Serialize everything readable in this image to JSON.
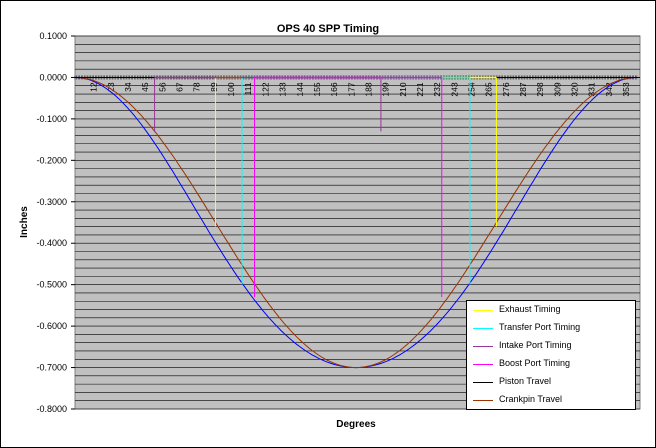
{
  "chart_data": {
    "type": "line",
    "title": "OPS 40 SPP Timing",
    "xlabel": "Degrees",
    "ylabel": "Inches",
    "ylim": [
      -0.8,
      0.1
    ],
    "xlim": [
      0,
      362
    ],
    "yticks": [
      0.1,
      0.0,
      -0.1,
      -0.2,
      -0.3,
      -0.4,
      -0.5,
      -0.6,
      -0.7,
      -0.8
    ],
    "yticklabels": [
      "0.1000",
      "0.0000",
      "-0.1000",
      "-0.2000",
      "-0.3000",
      "-0.4000",
      "-0.5000",
      "-0.6000",
      "-0.7000",
      "-0.8000"
    ],
    "xticklabels": [
      "12",
      "23",
      "34",
      "45",
      "56",
      "67",
      "78",
      "89",
      "100",
      "111",
      "122",
      "133",
      "144",
      "155",
      "166",
      "177",
      "188",
      "199",
      "210",
      "221",
      "232",
      "243",
      "254",
      "265",
      "276",
      "287",
      "298",
      "309",
      "320",
      "331",
      "342",
      "353"
    ],
    "legend_position": "bottom-right",
    "grid": true,
    "series": [
      {
        "name": "Exhaust Timing",
        "color": "#ffff00",
        "open_deg": 90,
        "close_deg": 270,
        "y_at_port": -0.36
      },
      {
        "name": "Transfer Port Timing",
        "color": "#00ffff",
        "open_deg": 107,
        "close_deg": 253,
        "y_at_port": -0.5
      },
      {
        "name": "Intake Port Timing",
        "color": "#993399",
        "open_deg": 51,
        "close_deg": 196,
        "y_at_port": -0.13
      },
      {
        "name": "Boost Port Timing",
        "color": "#ff00ff",
        "open_deg": 115,
        "close_deg": 235,
        "y_at_port": -0.53
      },
      {
        "name": "Piston Travel",
        "color": "#000000",
        "stroke_in": 0.7
      },
      {
        "name": "Crankpin Travel",
        "color": "#993300",
        "stroke_in": 0.7
      },
      {
        "name": "",
        "color": "#0000ff",
        "stroke_in": 0.7
      }
    ]
  }
}
